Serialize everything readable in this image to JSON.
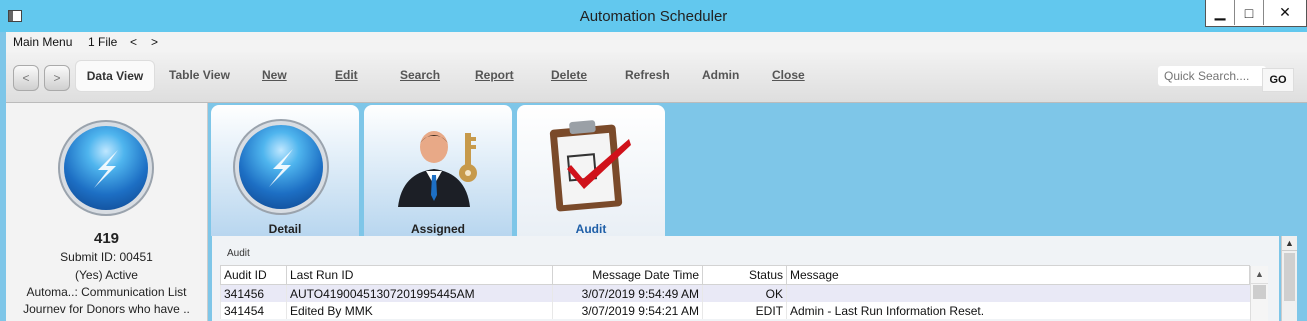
{
  "window": {
    "title": "Automation Scheduler",
    "controls": {
      "minimize": "▁",
      "maximize": "□",
      "close": "✕"
    }
  },
  "menubar": {
    "main_menu": "Main Menu",
    "file_count": "1 File",
    "prev": "<",
    "next": ">"
  },
  "toolbar": {
    "back": "<",
    "forward": ">",
    "buttons": [
      "Data View",
      "Table View",
      "New",
      "Edit",
      "Search",
      "Report",
      "Delete",
      "Refresh",
      "Admin",
      "Close"
    ],
    "search_placeholder": "Quick Search....",
    "go": "GO"
  },
  "record": {
    "number": "419",
    "submit_id": "Submit ID: 00451",
    "status": "(Yes) Active",
    "automation": "Automa..: Communication List",
    "description": "Journev for Donors who have .."
  },
  "tabs": [
    {
      "label": "Detail",
      "icon": "lightning-orb-icon",
      "active": false
    },
    {
      "label": "Assigned",
      "icon": "user-key-icon",
      "active": false
    },
    {
      "label": "Audit",
      "icon": "clipboard-check-icon",
      "active": true
    }
  ],
  "audit": {
    "section_label": "Audit",
    "columns": [
      "Audit ID",
      "Last Run ID",
      "Message Date Time",
      "Status",
      "Message"
    ],
    "rows": [
      {
        "audit_id": "341456",
        "last_run_id": "AUTO41900451307201995445AM",
        "datetime": "3/07/2019 9:54:49 AM",
        "status": "OK",
        "message": ""
      },
      {
        "audit_id": "341454",
        "last_run_id": "Edited By MMK",
        "datetime": "3/07/2019 9:54:21 AM",
        "status": "EDIT",
        "message": "Admin - Last Run Information Reset."
      }
    ]
  },
  "colors": {
    "titlebar": "#62c8ee",
    "background": "#7ec6e8",
    "active_tab_text": "#1f5fa8",
    "selected_row": "#e9e9f6"
  }
}
